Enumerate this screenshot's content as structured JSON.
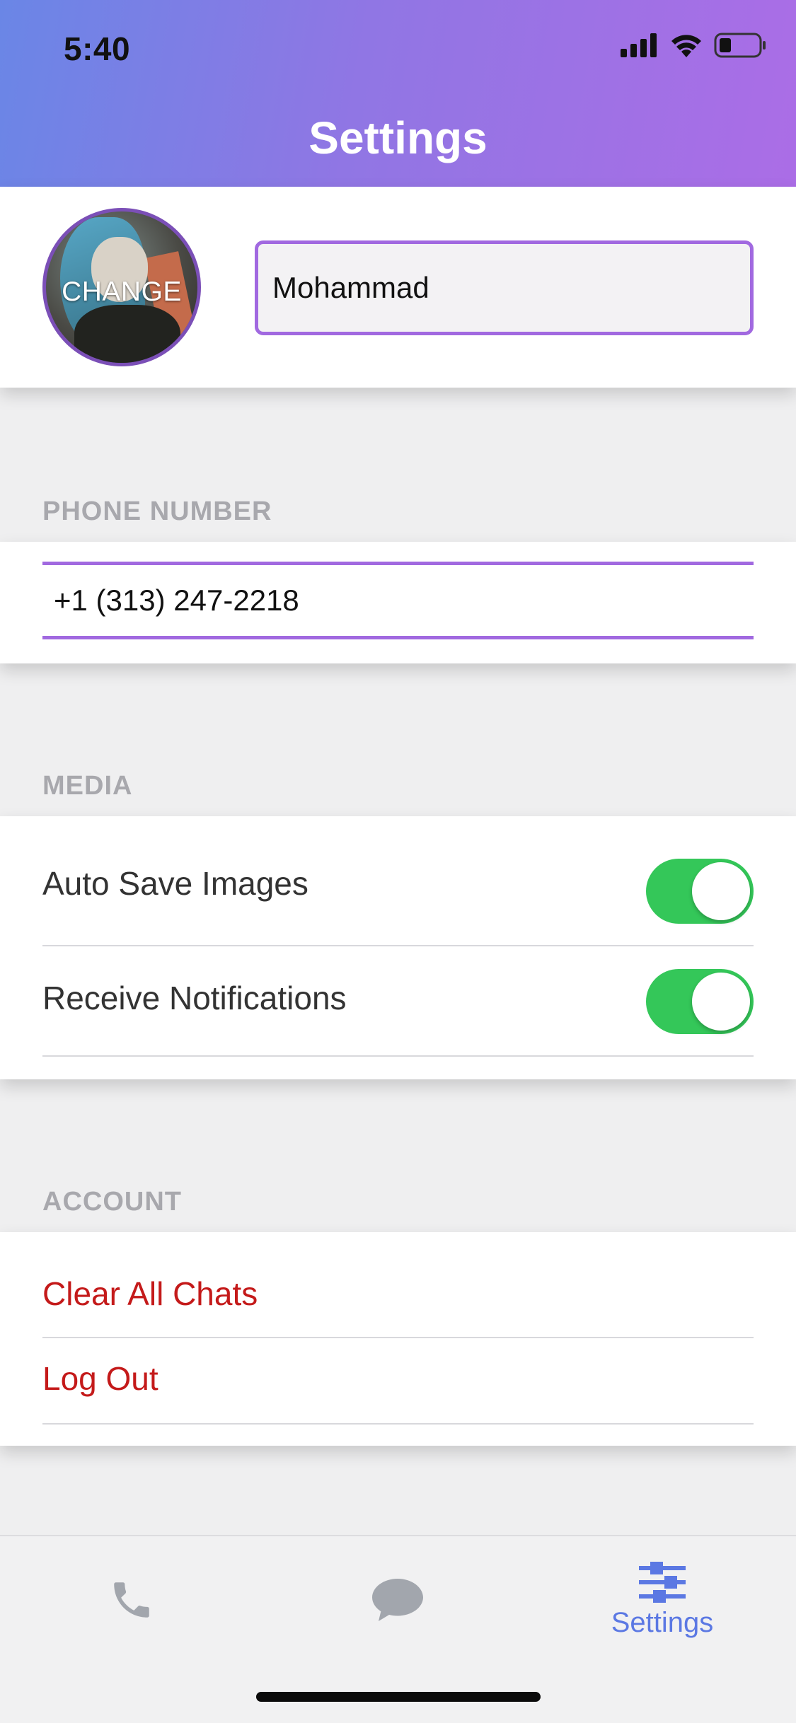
{
  "status_bar": {
    "time": "5:40"
  },
  "header": {
    "title": "Settings"
  },
  "profile": {
    "avatar_label": "CHANGE",
    "name_value": "Mohammad"
  },
  "phone_section": {
    "header": "PHONE NUMBER",
    "phone_value": "+1 (313) 247-2218"
  },
  "media_section": {
    "header": "MEDIA",
    "items": [
      {
        "label": "Auto Save Images",
        "enabled": true
      },
      {
        "label": "Receive Notifications",
        "enabled": true
      }
    ]
  },
  "account_section": {
    "header": "ACCOUNT",
    "actions": [
      {
        "label": "Clear All Chats"
      },
      {
        "label": "Log Out"
      }
    ]
  },
  "tabbar": {
    "tabs": [
      {
        "icon": "phone-icon",
        "label": ""
      },
      {
        "icon": "chat-bubble-icon",
        "label": ""
      },
      {
        "icon": "sliders-icon",
        "label": "Settings",
        "active": true
      }
    ]
  },
  "colors": {
    "accent_purple": "#a169e0",
    "toggle_on": "#34c759",
    "destructive": "#c41a1a",
    "tab_active": "#5b78e3"
  }
}
